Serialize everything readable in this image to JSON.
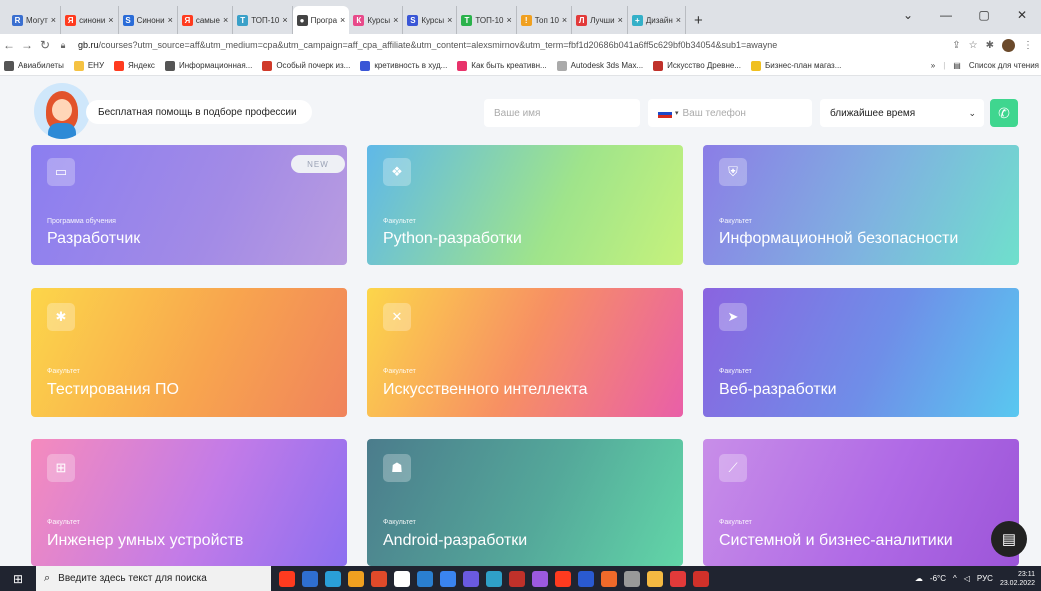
{
  "browser": {
    "tabs": [
      {
        "label": "Могут",
        "favColor": "#3a6fd0",
        "favText": "R"
      },
      {
        "label": "синони",
        "favColor": "#ff3b1f",
        "favText": "Я"
      },
      {
        "label": "Синони",
        "favColor": "#2a6cd8",
        "favText": "S"
      },
      {
        "label": "самые",
        "favColor": "#ff3b1f",
        "favText": "Я"
      },
      {
        "label": "ТОП-10",
        "favColor": "#3aa0c8",
        "favText": "T"
      },
      {
        "label": "Програ",
        "favColor": "#444444",
        "favText": "●",
        "active": true
      },
      {
        "label": "Курсы",
        "favColor": "#e84a8a",
        "favText": "К"
      },
      {
        "label": "Курсы",
        "favColor": "#3a56d6",
        "favText": "S"
      },
      {
        "label": "ТОП-10",
        "favColor": "#2bb24c",
        "favText": "Т"
      },
      {
        "label": "Топ 10",
        "favColor": "#f0a020",
        "favText": "!"
      },
      {
        "label": "Лучши",
        "favColor": "#e23a3a",
        "favText": "Л"
      },
      {
        "label": "Дизайн",
        "favColor": "#34b0c8",
        "favText": "+"
      }
    ],
    "tab_close": "×",
    "new_tab": "+",
    "window_controls": [
      "⌄",
      "—",
      "▢",
      "✕"
    ],
    "url_host": "gb.ru",
    "url_path": "/courses?utm_source=aff&utm_medium=cpa&utm_campaign=aff_cpa_affiliate&utm_content=alexsmirnov&utm_term=fbf1d20686b041a6ff5c629bf0b34054&sub1=awayne",
    "bookmarks": [
      {
        "label": "Авиабилеты",
        "color": "#555"
      },
      {
        "label": "ЕНУ",
        "color": "#f5c242"
      },
      {
        "label": "Яндекс",
        "color": "#ff3b1f"
      },
      {
        "label": "Информационная...",
        "color": "#555"
      },
      {
        "label": "Особый почерк из...",
        "color": "#d03a2a"
      },
      {
        "label": "кретивность в худ...",
        "color": "#3a56d6"
      },
      {
        "label": "Как быть креативн...",
        "color": "#e8336b"
      },
      {
        "label": "Autodesk 3ds Max...",
        "color": "#aaa"
      },
      {
        "label": "Искусство Древне...",
        "color": "#c0312a"
      },
      {
        "label": "Бизнес-план магаз...",
        "color": "#f0c020"
      }
    ],
    "bookmarks_more": "»",
    "reading_list": "Список для чтения"
  },
  "header": {
    "help_text": "Бесплатная помощь в подборе профессии",
    "name_placeholder": "Ваше имя",
    "phone_placeholder": "Ваш телефон",
    "time_value": "ближайшее время"
  },
  "cards": [
    {
      "kind": "Программа обучения",
      "title": "Разработчик",
      "badge": "NEW",
      "icon": "▭",
      "grad": "linear-gradient(115deg,#8b7ef0,#a38be6 60%,#b99ce0)"
    },
    {
      "kind": "Факультет",
      "title": "Python-разработки",
      "icon": "❖",
      "grad": "linear-gradient(115deg,#5fb8e8,#9fe48b 60%,#c6f27c)"
    },
    {
      "kind": "Факультет",
      "title": "Информационной безопасности",
      "icon": "⛨",
      "grad": "linear-gradient(115deg,#8b7de6,#7fb3e0 55%,#6fe0cc)"
    },
    {
      "kind": "Факультет",
      "title": "Тестирования ПО",
      "icon": "✱",
      "grad": "linear-gradient(115deg,#fcd64a,#f8a54e 55%,#f0835c)"
    },
    {
      "kind": "Факультет",
      "title": "Искусственного интеллекта",
      "icon": "✕",
      "grad": "linear-gradient(115deg,#fcd64a,#f79063 50%,#e95fa8)"
    },
    {
      "kind": "Факультет",
      "title": "Веб-разработки",
      "icon": "➤",
      "grad": "linear-gradient(115deg,#8a64e0,#6f8ee8 55%,#59c8f0)"
    },
    {
      "kind": "Факультет",
      "title": "Инженер умных устройств",
      "icon": "⊞",
      "grad": "linear-gradient(115deg,#f58bbd,#c27be8 55%,#8c6ff0)"
    },
    {
      "kind": "Факультет",
      "title": "Android-разработки",
      "icon": "☗",
      "grad": "linear-gradient(115deg,#4b7c8c,#54a89a 55%,#62d6a8)"
    },
    {
      "kind": "Факультет",
      "title": "Системной и бизнес-аналитики",
      "icon": "⟋",
      "grad": "linear-gradient(115deg,#c88ee8,#b06ae6 55%,#9c55d8)"
    }
  ],
  "taskbar": {
    "search_text": "Введите здесь текст для поиска",
    "apps": [
      "#ff3b1f",
      "#2f6fd0",
      "#2a9fd8",
      "#f0a020",
      "#e04a2a",
      "#ffffff",
      "#2a7fd0",
      "#3a84f0",
      "#6a5ae0",
      "#2fa0c8",
      "#c0312a",
      "#9c5ae0",
      "#ff3b1f",
      "#2a5ad0",
      "#f06a2a",
      "#999999",
      "#f5b942",
      "#e23a3a",
      "#d0312a"
    ],
    "temp": "-6°C",
    "lang": "РУС",
    "time": "23:11",
    "date": "23.02.2022"
  }
}
